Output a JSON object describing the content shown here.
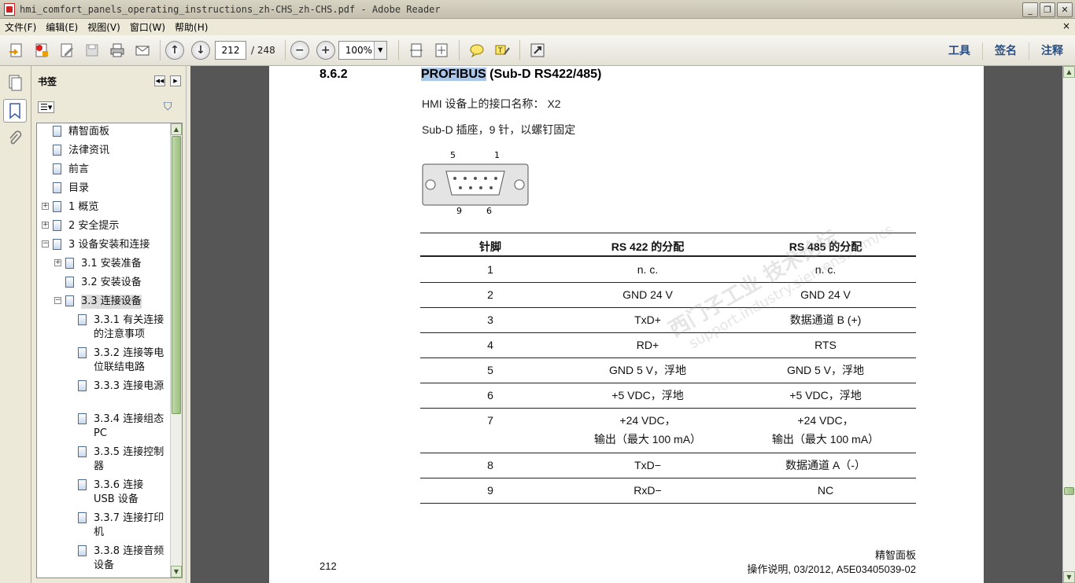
{
  "window": {
    "title": "hmi_comfort_panels_operating_instructions_zh-CHS_zh-CHS.pdf - Adobe Reader",
    "minimize": "_",
    "restore": "❐",
    "close": "✕"
  },
  "menu": [
    "文件(F)",
    "编辑(E)",
    "视图(V)",
    "窗口(W)",
    "帮助(H)"
  ],
  "menu_close": "×",
  "toolbar": {
    "current_page": "212",
    "total_pages": "/ 248",
    "zoom": "100%",
    "right_buttons": [
      "工具",
      "签名",
      "注释"
    ]
  },
  "bookmarks_panel": {
    "title": "书签",
    "items": [
      {
        "label": "精智面板",
        "level": 0,
        "expander": ""
      },
      {
        "label": "法律资讯",
        "level": 0,
        "expander": ""
      },
      {
        "label": "前言",
        "level": 0,
        "expander": ""
      },
      {
        "label": "目录",
        "level": 0,
        "expander": ""
      },
      {
        "label": "1 概览",
        "level": 0,
        "expander": "+"
      },
      {
        "label": "2 安全提示",
        "level": 0,
        "expander": "+"
      },
      {
        "label": "3 设备安装和连接",
        "level": 0,
        "expander": "−"
      },
      {
        "label": "3.1 安装准备",
        "level": 1,
        "expander": "+"
      },
      {
        "label": "3.2 安装设备",
        "level": 1,
        "expander": ""
      },
      {
        "label": "3.3 连接设备",
        "level": 1,
        "expander": "−",
        "selected": true
      },
      {
        "label": "3.3.1 有关连接的注意事项",
        "level": 2,
        "expander": ""
      },
      {
        "label": "3.3.2 连接等电位联结电路",
        "level": 2,
        "expander": ""
      },
      {
        "label": "3.3.3 连接电源",
        "level": 2,
        "expander": ""
      },
      {
        "label": "3.3.4 连接组态 PC",
        "level": 2,
        "expander": ""
      },
      {
        "label": "3.3.5 连接控制器",
        "level": 2,
        "expander": ""
      },
      {
        "label": "3.3.6 连接 USB 设备",
        "level": 2,
        "expander": ""
      },
      {
        "label": "3.3.7 连接打印机",
        "level": 2,
        "expander": ""
      },
      {
        "label": "3.3.8 连接音频设备",
        "level": 2,
        "expander": ""
      }
    ]
  },
  "document": {
    "section_number": "8.6.2",
    "heading_highlight": "PROFIBUS",
    "heading_rest": " (Sub-D RS422/485)",
    "line1": "HMI 设备上的接口名称： X2",
    "line2": "Sub-D 插座，9 针，以螺钉固定",
    "connector_labels": {
      "top_left": "5",
      "top_right": "1",
      "bottom_left": "9",
      "bottom_right": "6"
    },
    "table": {
      "headers": [
        "针脚",
        "RS 422 的分配",
        "RS 485 的分配"
      ],
      "rows": [
        [
          "1",
          "n. c.",
          "n. c."
        ],
        [
          "2",
          "GND 24 V",
          "GND 24 V"
        ],
        [
          "3",
          "TxD+",
          "数据通道 B (+)"
        ],
        [
          "4",
          "RD+",
          "RTS"
        ],
        [
          "5",
          "GND 5 V，浮地",
          "GND 5 V，浮地"
        ],
        [
          "6",
          "+5 VDC，浮地",
          "+5 VDC，浮地"
        ],
        [
          "7",
          "+24 VDC，\n输出（最大 100 mA）",
          "+24 VDC，\n输出（最大 100 mA）"
        ],
        [
          "8",
          "TxD−",
          "数据通道 A（-）"
        ],
        [
          "9",
          "RxD−",
          "NC"
        ]
      ]
    },
    "watermark_cn": "西门子工业 技术论坛",
    "watermark_url": "support.industry.siemens.com/cs",
    "footer_page": "212",
    "footer_product": "精智面板",
    "footer_doc": "操作说明, 03/2012, A5E03405039-02"
  },
  "colors": {
    "highlight": "#a9c7ea",
    "doc_bg": "#565656",
    "accent": "#2a4d80"
  }
}
